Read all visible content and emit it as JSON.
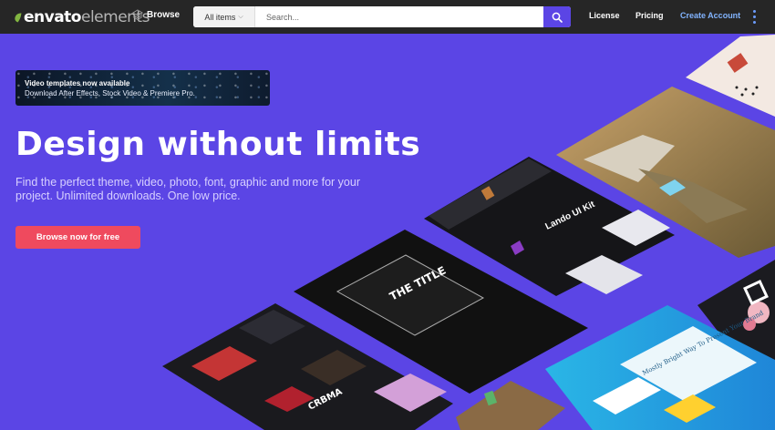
{
  "nav": {
    "logo_brand": "envato",
    "logo_suffix": "elements",
    "browse_label": "Browse",
    "category_label": "All items",
    "search_placeholder": "Search...",
    "license_label": "License",
    "pricing_label": "Pricing",
    "create_account_label": "Create Account"
  },
  "promo": {
    "title": "Video templates now available",
    "subtitle": "Download After Effects, Stock Video & Premiere Pro."
  },
  "hero": {
    "headline": "Design without limits",
    "subtext": "Find the perfect theme, video, photo, font, graphic and more for your project. Unlimited downloads. One low price.",
    "cta_label": "Browse now for free"
  },
  "collage": {
    "kit_title": "Lando UI Kit",
    "title_card": "THE TITLE",
    "orma_label": "CRBMA",
    "brand_slogan": "Mostly Bright Way To Present Your Brand"
  },
  "colors": {
    "hero_bg": "#5b45e5",
    "nav_bg": "#262626",
    "cta_bg": "#ef4a5e",
    "accent_link": "#82b4ff",
    "logo_leaf": "#82b541"
  },
  "icons": [
    "envato-leaf-icon",
    "browse-icon",
    "chevron-down-icon",
    "search-icon",
    "more-vertical-icon"
  ]
}
